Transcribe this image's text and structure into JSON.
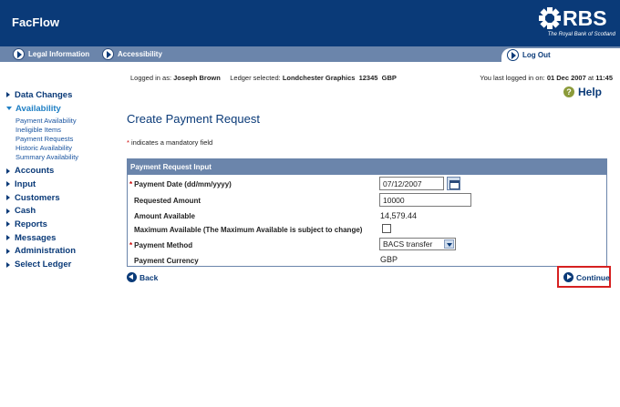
{
  "app": {
    "title": "FacFlow"
  },
  "brand": {
    "name": "RBS",
    "tagline": "The Royal Bank of Scotland"
  },
  "nav": {
    "items": [
      {
        "label": "Legal Information"
      },
      {
        "label": "Accessibility"
      }
    ],
    "logout_label": "Log Out"
  },
  "session": {
    "logged_in_prefix": "Logged in as:",
    "user": "Joseph Brown",
    "ledger_prefix": "Ledger selected:",
    "ledger": "Londchester Graphics  12345  GBP",
    "last_login_prefix": "You last logged in on:",
    "last_login": "01 Dec 2007",
    "last_login_at": "at",
    "last_login_time": "11:45"
  },
  "help_label": "Help",
  "sidebar": {
    "items": [
      {
        "label": "Data Changes"
      },
      {
        "label": "Availability",
        "open": true,
        "children": [
          "Payment Availability",
          "Ineligible Items",
          "Payment Requests",
          "Historic Availability",
          "Summary Availability"
        ]
      },
      {
        "label": "Accounts"
      },
      {
        "label": "Input"
      },
      {
        "label": "Customers"
      },
      {
        "label": "Cash"
      },
      {
        "label": "Reports"
      },
      {
        "label": "Messages"
      },
      {
        "label": "Administration"
      },
      {
        "label": "Select Ledger"
      }
    ]
  },
  "page": {
    "title": "Create Payment Request",
    "mandatory_star": "*",
    "mandatory_note": " indicates a mandatory field"
  },
  "form": {
    "header": "Payment Request Input",
    "payment_date_label": "Payment Date (dd/mm/yyyy)",
    "payment_date_value": "07/12/2007",
    "requested_amount_label": "Requested Amount",
    "requested_amount_value": "10000",
    "amount_available_label": "Amount Available",
    "amount_available_value": "14,579.44",
    "max_available_label": "Maximum Available (The Maximum Available is subject to change)",
    "payment_method_label": "Payment Method",
    "payment_method_value": "BACS transfer",
    "payment_currency_label": "Payment Currency",
    "payment_currency_value": "GBP"
  },
  "actions": {
    "back_label": "Back",
    "continue_label": "Continue"
  },
  "colors": {
    "header_bg": "#0a3a78",
    "nav_bg": "#6b85ab",
    "link": "#0a3a78",
    "highlight": "#d62020",
    "mandatory": "#cc0000"
  }
}
